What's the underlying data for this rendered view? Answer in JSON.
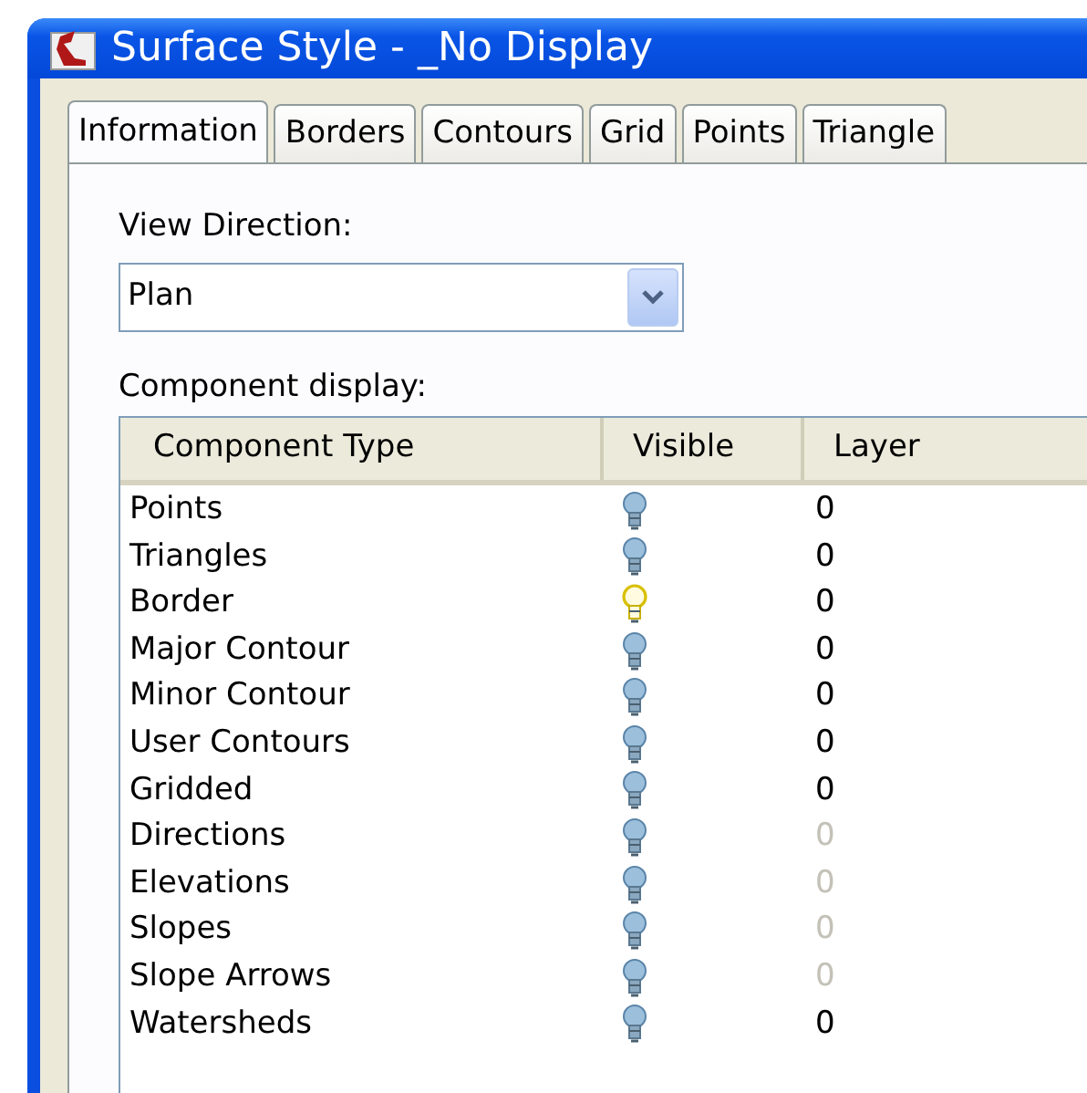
{
  "window": {
    "title": "Surface Style - _No Display"
  },
  "tabs": [
    {
      "label": "Information",
      "selected": true
    },
    {
      "label": "Borders",
      "selected": false
    },
    {
      "label": "Contours",
      "selected": false
    },
    {
      "label": "Grid",
      "selected": false
    },
    {
      "label": "Points",
      "selected": false
    },
    {
      "label": "Triangle",
      "selected": false
    }
  ],
  "view_direction": {
    "label": "View Direction:",
    "value": "Plan"
  },
  "component_display": {
    "label": "Component display:",
    "columns": [
      "Component Type",
      "Visible",
      "Layer"
    ],
    "rows": [
      {
        "name": "Points",
        "visible": false,
        "layer": "0",
        "disabled": false
      },
      {
        "name": "Triangles",
        "visible": false,
        "layer": "0",
        "disabled": false
      },
      {
        "name": "Border",
        "visible": true,
        "layer": "0",
        "disabled": false
      },
      {
        "name": "Major Contour",
        "visible": false,
        "layer": "0",
        "disabled": false
      },
      {
        "name": "Minor Contour",
        "visible": false,
        "layer": "0",
        "disabled": false
      },
      {
        "name": "User Contours",
        "visible": false,
        "layer": "0",
        "disabled": false
      },
      {
        "name": "Gridded",
        "visible": false,
        "layer": "0",
        "disabled": false
      },
      {
        "name": "Directions",
        "visible": false,
        "layer": "0",
        "disabled": true
      },
      {
        "name": "Elevations",
        "visible": false,
        "layer": "0",
        "disabled": true
      },
      {
        "name": "Slopes",
        "visible": false,
        "layer": "0",
        "disabled": true
      },
      {
        "name": "Slope Arrows",
        "visible": false,
        "layer": "0",
        "disabled": true
      },
      {
        "name": "Watersheds",
        "visible": false,
        "layer": "0",
        "disabled": false
      }
    ]
  }
}
